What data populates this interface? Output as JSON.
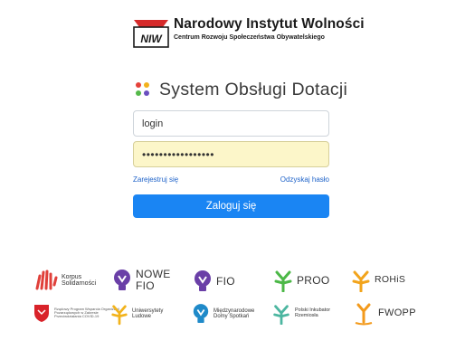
{
  "header": {
    "logo_mark": "NIW",
    "title": "Narodowy Instytut Wolności",
    "subtitle": "Centrum Rozwoju Społeczeństwa Obywatelskiego"
  },
  "system": {
    "title": "System Obsługi Dotacji",
    "dot_colors": [
      "#e5413a",
      "#f3b21c",
      "#55b94a",
      "#6a4fbf"
    ]
  },
  "form": {
    "login_value": "login",
    "password_value": "•••••••••••••••••",
    "register_link": "Zarejestruj się",
    "recover_link": "Odzyskaj hasło",
    "submit_label": "Zaloguj się"
  },
  "partners": {
    "row1": [
      {
        "lines": [
          "Korpus",
          "Solidarności"
        ],
        "icon": "korpus-hands-icon",
        "color": "#e0403a"
      },
      {
        "lines": [
          "NOWE",
          "FIO"
        ],
        "icon": "bulb-icon",
        "color": "#6a3fa7"
      },
      {
        "lines": [
          "FIO"
        ],
        "icon": "bulb-icon",
        "color": "#6a3fa7"
      },
      {
        "lines": [
          "PROO"
        ],
        "icon": "sprout-icon",
        "color": "#4cb847"
      },
      {
        "lines": [
          "ROHiS"
        ],
        "icon": "sprout-icon",
        "color": "#f2a41c"
      }
    ],
    "row2": [
      {
        "lines": [
          "Rządowy Program Wsparcia Organizacji",
          "Pozarządowych w Zakresie",
          "Przeciwdziałania COVID-19"
        ],
        "icon": "shield-icon",
        "color": "#d9232a"
      },
      {
        "lines": [
          "Uniwersytety",
          "Ludowe"
        ],
        "icon": "sprout-icon",
        "color": "#f2b31c"
      },
      {
        "lines": [
          "Międzynarodowe",
          "Domy Spotkań"
        ],
        "icon": "bulb-icon",
        "color": "#1f8ac9"
      },
      {
        "lines": [
          "Polski Inkubator",
          "Rzemiosła"
        ],
        "icon": "sprout-icon",
        "color": "#4cb6a0"
      },
      {
        "lines": [
          "FWOPP"
        ],
        "icon": "sprout-icon",
        "color": "#f39a1c"
      }
    ]
  }
}
